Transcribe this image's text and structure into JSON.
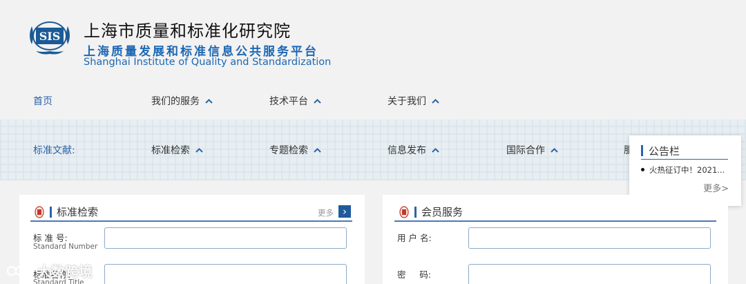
{
  "header": {
    "logo_text": "SIS",
    "title_cn": "上海市质量和标准化研究院",
    "platform_name": "上海质量发展和标准信息公共服务平台",
    "title_en": "Shanghai Institute of Quality and Standardization"
  },
  "nav_top": [
    {
      "label": "首页",
      "has_chevron": false
    },
    {
      "label": "我们的服务",
      "has_chevron": true
    },
    {
      "label": "技术平台",
      "has_chevron": true
    },
    {
      "label": "关于我们",
      "has_chevron": true
    }
  ],
  "nav_secondary": [
    {
      "label": "标准文献:",
      "has_chevron": false
    },
    {
      "label": "标准检索",
      "has_chevron": true
    },
    {
      "label": "专题检索",
      "has_chevron": true
    },
    {
      "label": "信息发布",
      "has_chevron": true
    },
    {
      "label": "国际合作",
      "has_chevron": true
    },
    {
      "label": "服",
      "has_chevron": false
    }
  ],
  "notice": {
    "title": "公告栏",
    "items": [
      "火热征订中！2021..."
    ],
    "more": "更多>"
  },
  "standard_search": {
    "title": "标准检索",
    "more": "更多",
    "more_arrow": "›",
    "fields": [
      {
        "label": "标 准 号:",
        "sub": "Standard Number",
        "value": ""
      },
      {
        "label": "标准名称:",
        "sub": "Standard Title",
        "value": ""
      }
    ]
  },
  "member": {
    "title": "会员服务",
    "fields": [
      {
        "label": "用 户 名:",
        "value": ""
      },
      {
        "label": "密     码:",
        "value": ""
      }
    ]
  },
  "watermark": {
    "text": "大数跨境"
  },
  "colors": {
    "accent": "#2a63a8",
    "brand_blue": "#1c67b3",
    "button": "#1e5a9c",
    "seal_red": "#c0392b"
  }
}
